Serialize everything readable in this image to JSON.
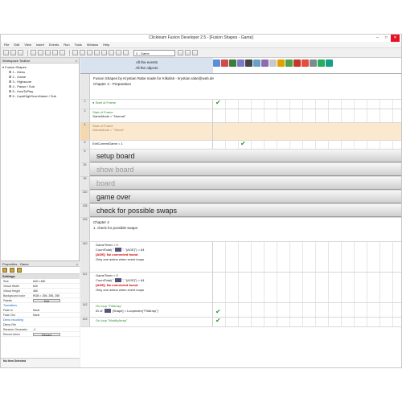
{
  "window": {
    "title": "Clickteam Fusion Developer 2.5 - [Fusion Shapes - Game]"
  },
  "menu": [
    "File",
    "Edit",
    "View",
    "Insert",
    "Events",
    "Run",
    "Tools",
    "Window",
    "Help"
  ],
  "toolbar": {
    "frame_select": "2 - Game"
  },
  "workspace": {
    "title": "Workspace Toolbar",
    "root": "Fusion Shapes",
    "frames": [
      "1 - Menu",
      "2 - Game",
      "3 - Highscore",
      "4 - Pause / Sub",
      "5 - HowToPlay",
      "6 - InputHighScoreName / Sub"
    ]
  },
  "properties": {
    "title": "Properties - Game",
    "section": "Settings",
    "rows": [
      {
        "k": "Size",
        "v": "640 x 480"
      },
      {
        "k": "Virtual Width",
        "v": "640"
      },
      {
        "k": "Virtual Height",
        "v": "480"
      },
      {
        "k": "Background color",
        "v": "RGB = 255, 255, 255"
      },
      {
        "k": "Palette",
        "v": "Edit"
      }
    ],
    "link": "Transitions",
    "rows2": [
      {
        "k": "Fade In",
        "v": "None"
      },
      {
        "k": "Fade Out",
        "v": "None"
      }
    ],
    "link2": "Demo recording",
    "rows3": [
      {
        "k": "Demo File",
        "v": ""
      },
      {
        "k": "Random Generator",
        "v": "-1"
      },
      {
        "k": "Record demo",
        "v": "Record"
      }
    ],
    "footer": "No Item Selected"
  },
  "events": {
    "all_events": "All the events",
    "all_objects": "All the objects",
    "comment_line1": "Fusion Shapes by Krystian Rabe made for Klikdisk - krystian.rabe@web.de",
    "comment_line2": "Chapter 4 - Preparation",
    "row2": {
      "num": "2",
      "lines": [
        "Start of Frame"
      ]
    },
    "row3": {
      "num": "3",
      "lines": [
        "Start of Frame",
        "GameMode = \"Normal\""
      ]
    },
    "row4": {
      "num": "4",
      "lines": [
        "Start of Frame",
        "GameMode = \"Timed\""
      ]
    },
    "row5": {
      "num": "5",
      "lines": [
        "ExitCurrentGame = 1"
      ]
    },
    "groups": [
      {
        "num": "6",
        "label": "setup board"
      },
      {
        "num": "26",
        "label": "show board"
      },
      {
        "num": "36",
        "label": "board"
      },
      {
        "num": "130",
        "label": "game over"
      },
      {
        "num": "138",
        "label": "check for possible swaps"
      }
    ],
    "ch_comment": {
      "num": "139",
      "line1": "Chapter 4",
      "line2": "1. check for possible swaps"
    },
    "row140": {
      "num": "140",
      "l1": "GameTimer = 0",
      "l2a": "CountTotal( \"",
      "l2b": "\", \"[AGE]\") = 64",
      "l3": "[AGE]: No connected found",
      "l4": "Only one action when event loops"
    },
    "row141": {
      "num": "141",
      "l1": "GameTimer = 0",
      "l2a": "CountTotal( \"",
      "l2b": "\", \"[AGE]\") = 64",
      "l3": "[AGE]: No connected found",
      "l4": "Only one action when event loops"
    },
    "row142": {
      "num": "142",
      "l1": "On loop \"FillArray\"",
      "l2a": "ID of",
      "l2b": "[Shape] = LoopIndex(\"FillArray\")"
    },
    "row143": {
      "num": "143",
      "l1": "On loop \"ModifyArray\""
    }
  }
}
